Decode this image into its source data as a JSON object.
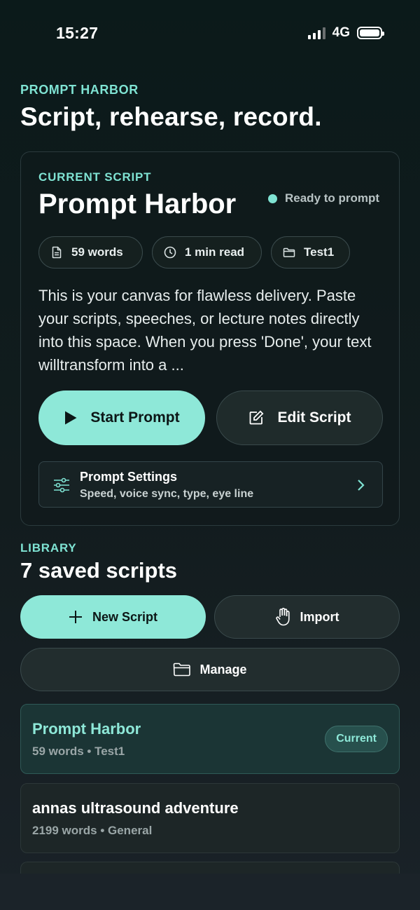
{
  "status_bar": {
    "time": "15:27",
    "network": "4G"
  },
  "header": {
    "kicker": "PROMPT HARBOR",
    "title": "Script, rehearse, record."
  },
  "current_script": {
    "kicker": "CURRENT SCRIPT",
    "title": "Prompt Harbor",
    "status": "Ready to prompt",
    "chips": {
      "words": "59 words",
      "read_time": "1 min read",
      "folder": "Test1"
    },
    "body": "This is your canvas for flawless delivery. Paste your scripts, speeches, or lecture notes directly into this space. When you press 'Done', your text willtransform into a ...",
    "start_label": "Start Prompt",
    "edit_label": "Edit Script",
    "settings": {
      "title": "Prompt Settings",
      "subtitle": "Speed, voice sync, type, eye line"
    }
  },
  "library": {
    "kicker": "LIBRARY",
    "title": "7 saved scripts",
    "new_label": "New Script",
    "import_label": "Import",
    "manage_label": "Manage",
    "items": [
      {
        "title": "Prompt Harbor",
        "meta": "59 words • Test1",
        "badge": "Current"
      },
      {
        "title": "annas ultrasound adventure",
        "meta": "2199 words • General"
      }
    ]
  },
  "colors": {
    "accent": "#8ee8d8",
    "kicker": "#7fe3d3",
    "background": "#0f1c1d"
  },
  "icons": [
    "document-icon",
    "clock-icon",
    "folder-icon",
    "play-icon",
    "edit-icon",
    "sliders-icon",
    "chevron-right-icon",
    "plus-icon",
    "hand-icon"
  ]
}
